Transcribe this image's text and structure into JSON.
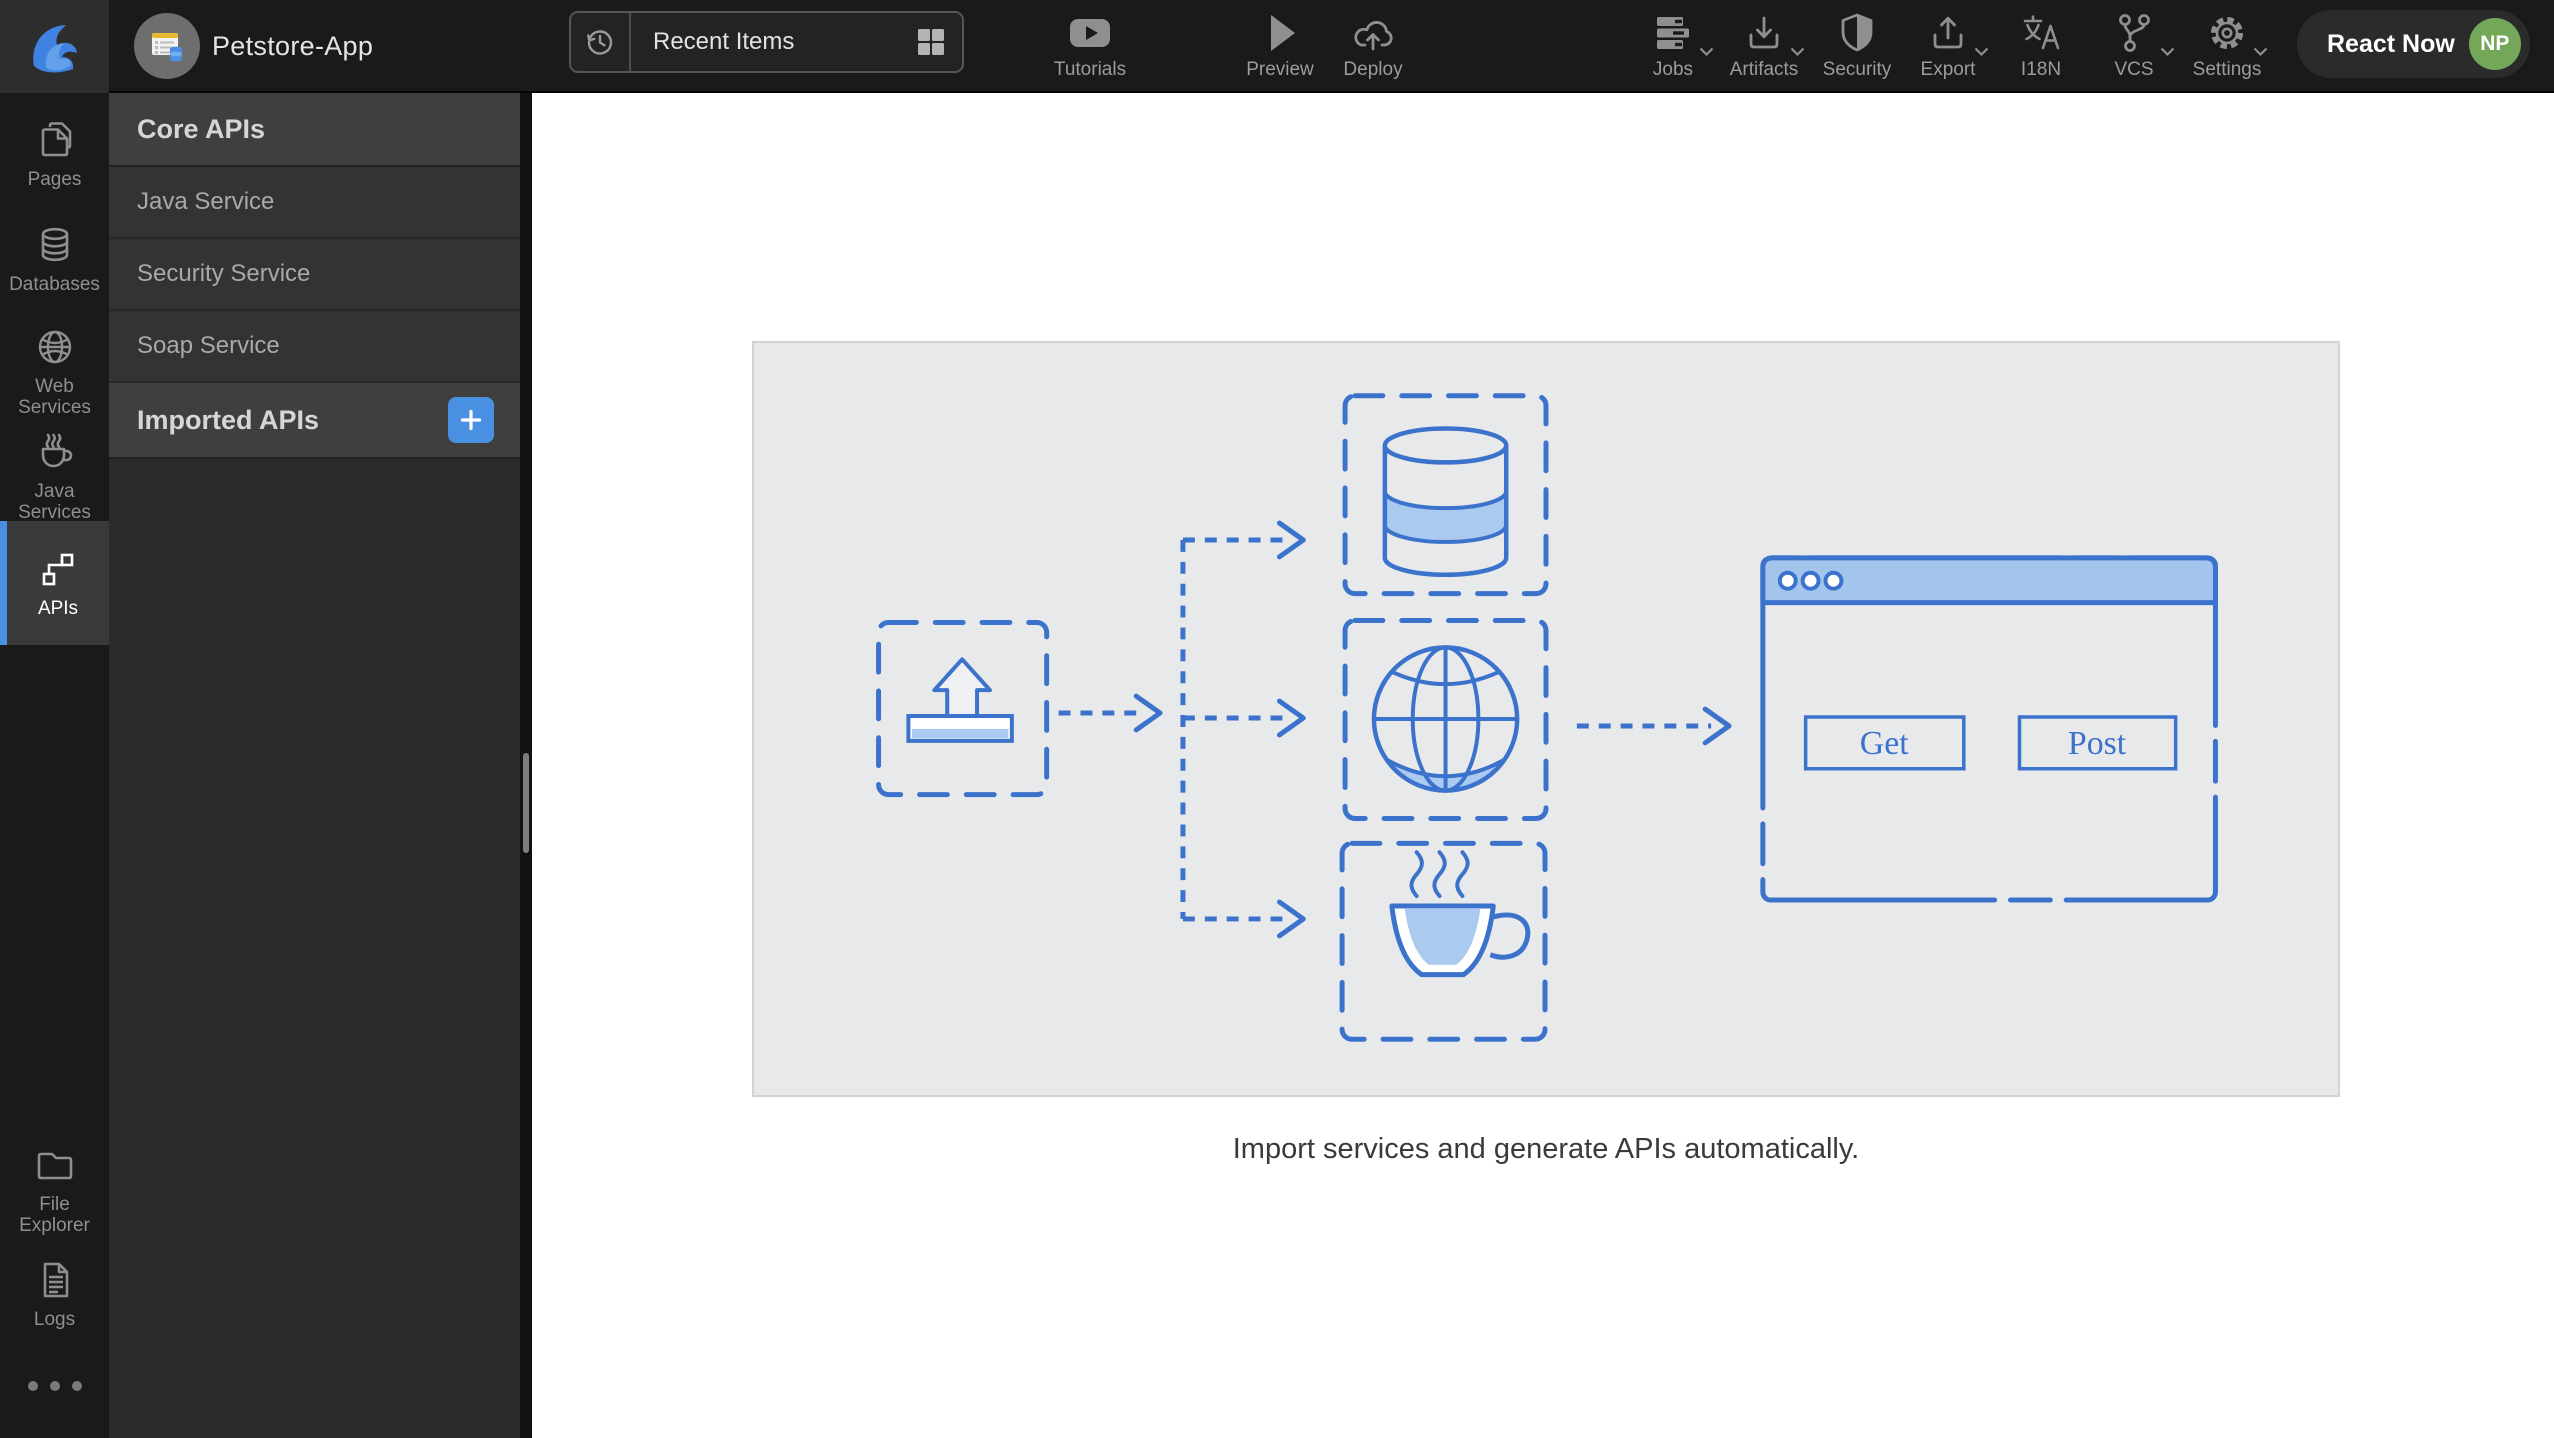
{
  "topbar": {
    "app_title": "Petstore-App",
    "recent_items": "Recent Items",
    "tools": [
      {
        "label": "Tutorials"
      },
      {
        "label": "Preview"
      },
      {
        "label": "Deploy"
      }
    ],
    "menus": [
      {
        "label": "Jobs",
        "chevron": true
      },
      {
        "label": "Artifacts",
        "chevron": true
      },
      {
        "label": "Security",
        "chevron": false
      },
      {
        "label": "Export",
        "chevron": true
      },
      {
        "label": "I18N",
        "chevron": false
      },
      {
        "label": "VCS",
        "chevron": true
      },
      {
        "label": "Settings",
        "chevron": true
      }
    ],
    "react_now_label": "React Now",
    "avatar_initials": "NP"
  },
  "sidebar": {
    "items": [
      {
        "label": "Pages",
        "active": false
      },
      {
        "label": "Databases",
        "active": false
      },
      {
        "label": "Web Services",
        "active": false
      },
      {
        "label": "Java Services",
        "active": false
      },
      {
        "label": "APIs",
        "active": true
      }
    ],
    "bottom_items": [
      {
        "label": "File Explorer"
      },
      {
        "label": "Logs"
      }
    ]
  },
  "panel": {
    "sections": [
      {
        "header": "Core APIs",
        "items": [
          "Java Service",
          "Security Service",
          "Soap Service"
        ]
      },
      {
        "header": "Imported APIs",
        "items": []
      }
    ]
  },
  "main": {
    "caption": "Import services and generate APIs automatically.",
    "diagram": {
      "get_label": "Get",
      "post_label": "Post"
    }
  },
  "colors": {
    "accent_blue": "#3b72cb",
    "light_blue": "#abcaf0",
    "browser_titlebar": "#a3c4ec",
    "plus_button": "#4a90e2",
    "avatar_green": "#74a758"
  }
}
